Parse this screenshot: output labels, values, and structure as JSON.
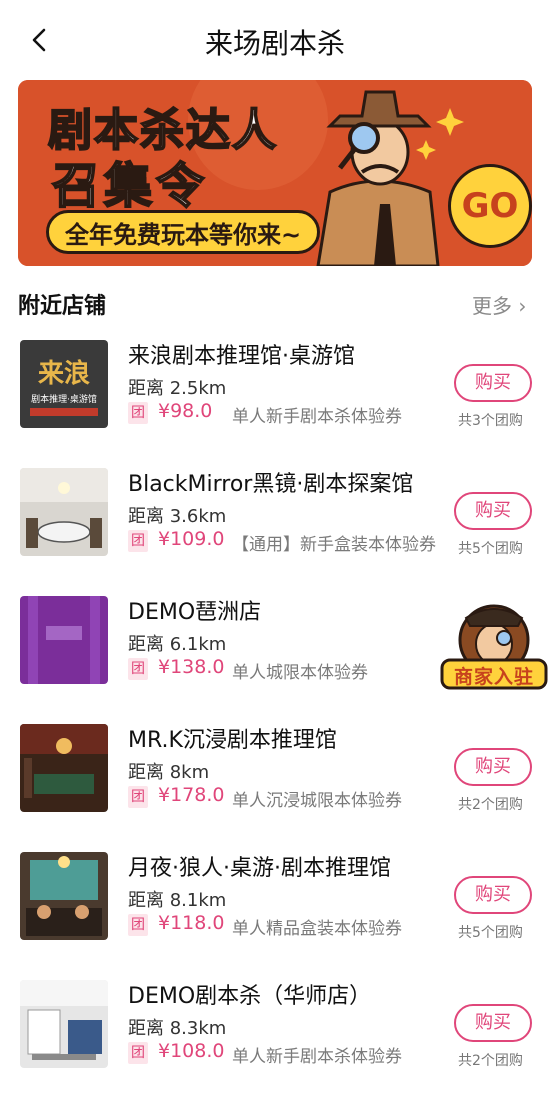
{
  "header": {
    "title": "来场剧本杀",
    "back_icon": "back-arrow-icon"
  },
  "banner": {
    "line1": "剧本杀达人",
    "line2": "召集令",
    "line3": "全年免费玩本等你来~",
    "go_label": "GO",
    "colors": {
      "background": "#d8522a",
      "accent": "#ffd23c"
    }
  },
  "section": {
    "title": "附近店铺",
    "more": "更多 ›"
  },
  "stores": [
    {
      "name": "来浪剧本推理馆·桌游馆",
      "distance": "距离 2.5km",
      "badge": "团",
      "price": "¥98.0",
      "deal": "单人新手剧本杀体验券",
      "buy": "购买",
      "count": "共3个团购"
    },
    {
      "name": "BlackMirror黑镜·剧本探案馆",
      "distance": "距离 3.6km",
      "badge": "团",
      "price": "¥109.0",
      "deal": "【通用】新手盒装本体验券",
      "buy": "购买",
      "count": "共5个团购"
    },
    {
      "name": "DEMO琶洲店",
      "distance": "距离 6.1km",
      "badge": "团",
      "price": "¥138.0",
      "deal": "单人城限本体验券",
      "buy": "",
      "count": ""
    },
    {
      "name": "MR.K沉浸剧本推理馆",
      "distance": "距离 8km",
      "badge": "团",
      "price": "¥178.0",
      "deal": "单人沉浸城限本体验券",
      "buy": "购买",
      "count": "共2个团购"
    },
    {
      "name": "月夜·狼人·桌游·剧本推理馆",
      "distance": "距离 8.1km",
      "badge": "团",
      "price": "¥118.0",
      "deal": "单人精品盒装本体验券",
      "buy": "购买",
      "count": "共5个团购"
    },
    {
      "name": "DEMO剧本杀（华师店）",
      "distance": "距离 8.3km",
      "badge": "团",
      "price": "¥108.0",
      "deal": "单人新手剧本杀体验券",
      "buy": "购买",
      "count": "共2个团购"
    }
  ],
  "thumbnails": {
    "store1_logo_text": "来浪",
    "store1_logo_sub": "剧本推理·桌游馆"
  },
  "merchant": {
    "label": "商家入驻"
  },
  "colors": {
    "accent": "#e0467a",
    "badge_bg": "#fce4ea"
  }
}
